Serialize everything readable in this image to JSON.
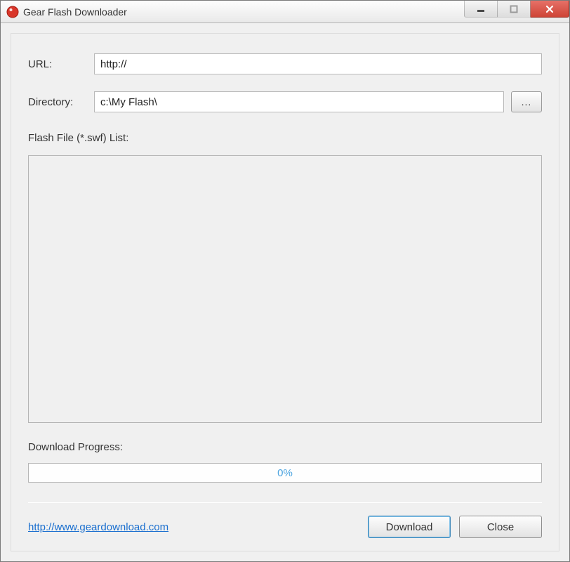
{
  "window": {
    "title": "Gear Flash Downloader"
  },
  "form": {
    "url_label": "URL:",
    "url_value": "http://",
    "directory_label": "Directory:",
    "directory_value": "c:\\My Flash\\",
    "browse_label": "..."
  },
  "list": {
    "label": "Flash File (*.swf) List:"
  },
  "progress": {
    "label": "Download Progress:",
    "text": "0%"
  },
  "footer": {
    "link_text": "http://www.geardownload.com",
    "download_label": "Download",
    "close_label": "Close"
  }
}
